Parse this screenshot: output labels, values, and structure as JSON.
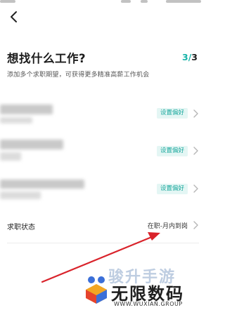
{
  "header": {
    "title": "想找什么工作?",
    "step_current": "3",
    "step_separator": "/",
    "step_total": "3",
    "subtitle": "添加多个求职期望，可获得更多精准高薪工作机会"
  },
  "preferences": [
    {
      "action_label": "设置偏好"
    },
    {
      "action_label": "设置偏好"
    },
    {
      "action_label": "设置偏好"
    }
  ],
  "job_status": {
    "label": "求职状态",
    "value": "在职-月内到岗"
  },
  "watermark": {
    "brand_top": "骏升手游",
    "brand_main": "无限数码",
    "url": "WWW.WUXIAN.GROUP"
  },
  "colors": {
    "accent": "#16b3a8",
    "tag_bg": "#e4f6f4",
    "arrow": "#d9232b"
  }
}
